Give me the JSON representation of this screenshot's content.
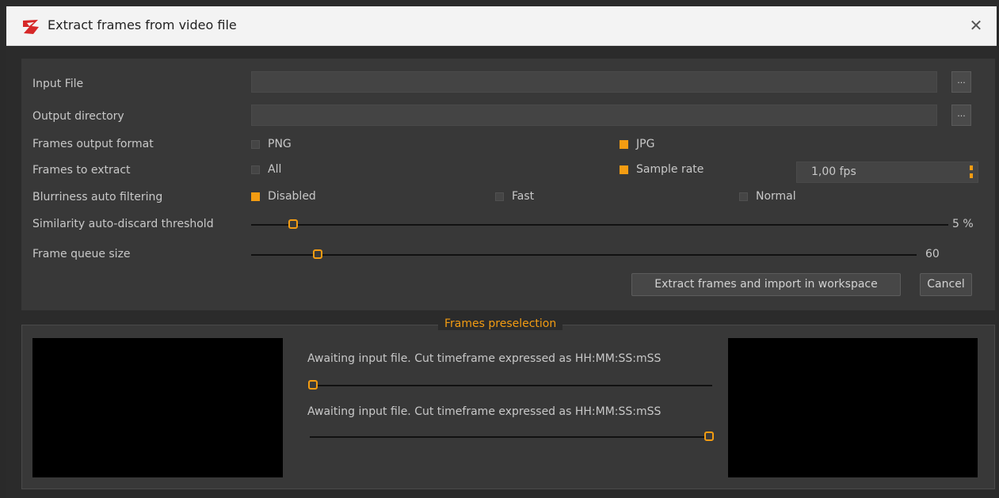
{
  "window": {
    "title": "Extract frames from video file",
    "close_glyph": "✕",
    "icon": "app-logo-icon",
    "accent_color": "#f39c12"
  },
  "form": {
    "input_file_label": "Input File",
    "input_file_value": "",
    "output_dir_label": "Output directory",
    "output_dir_value": "",
    "browse_label": "...",
    "format_label": "Frames output format",
    "format_png": "PNG",
    "format_jpg": "JPG",
    "format_selected": "JPG",
    "extract_label": "Frames to extract",
    "extract_all": "All",
    "extract_sample": "Sample rate",
    "extract_selected": "Sample rate",
    "sample_rate_value": "1,00 fps",
    "blur_label": "Blurriness auto filtering",
    "blur_disabled": "Disabled",
    "blur_fast": "Fast",
    "blur_normal": "Normal",
    "blur_selected": "Disabled",
    "similarity_label": "Similarity auto-discard threshold",
    "similarity_value": "5 %",
    "similarity_fraction": 0.05,
    "queue_label": "Frame queue size",
    "queue_value": "60",
    "queue_fraction": 0.1
  },
  "buttons": {
    "extract": "Extract frames and import in workspace",
    "cancel": "Cancel"
  },
  "preselection": {
    "title": "Frames preselection",
    "start_status": "Awaiting input file. Cut timeframe expressed as HH:MM:SS:mSS",
    "end_status": "Awaiting input file. Cut timeframe expressed as HH:MM:SS:mSS",
    "start_fraction": 0.0,
    "end_fraction": 1.0
  }
}
